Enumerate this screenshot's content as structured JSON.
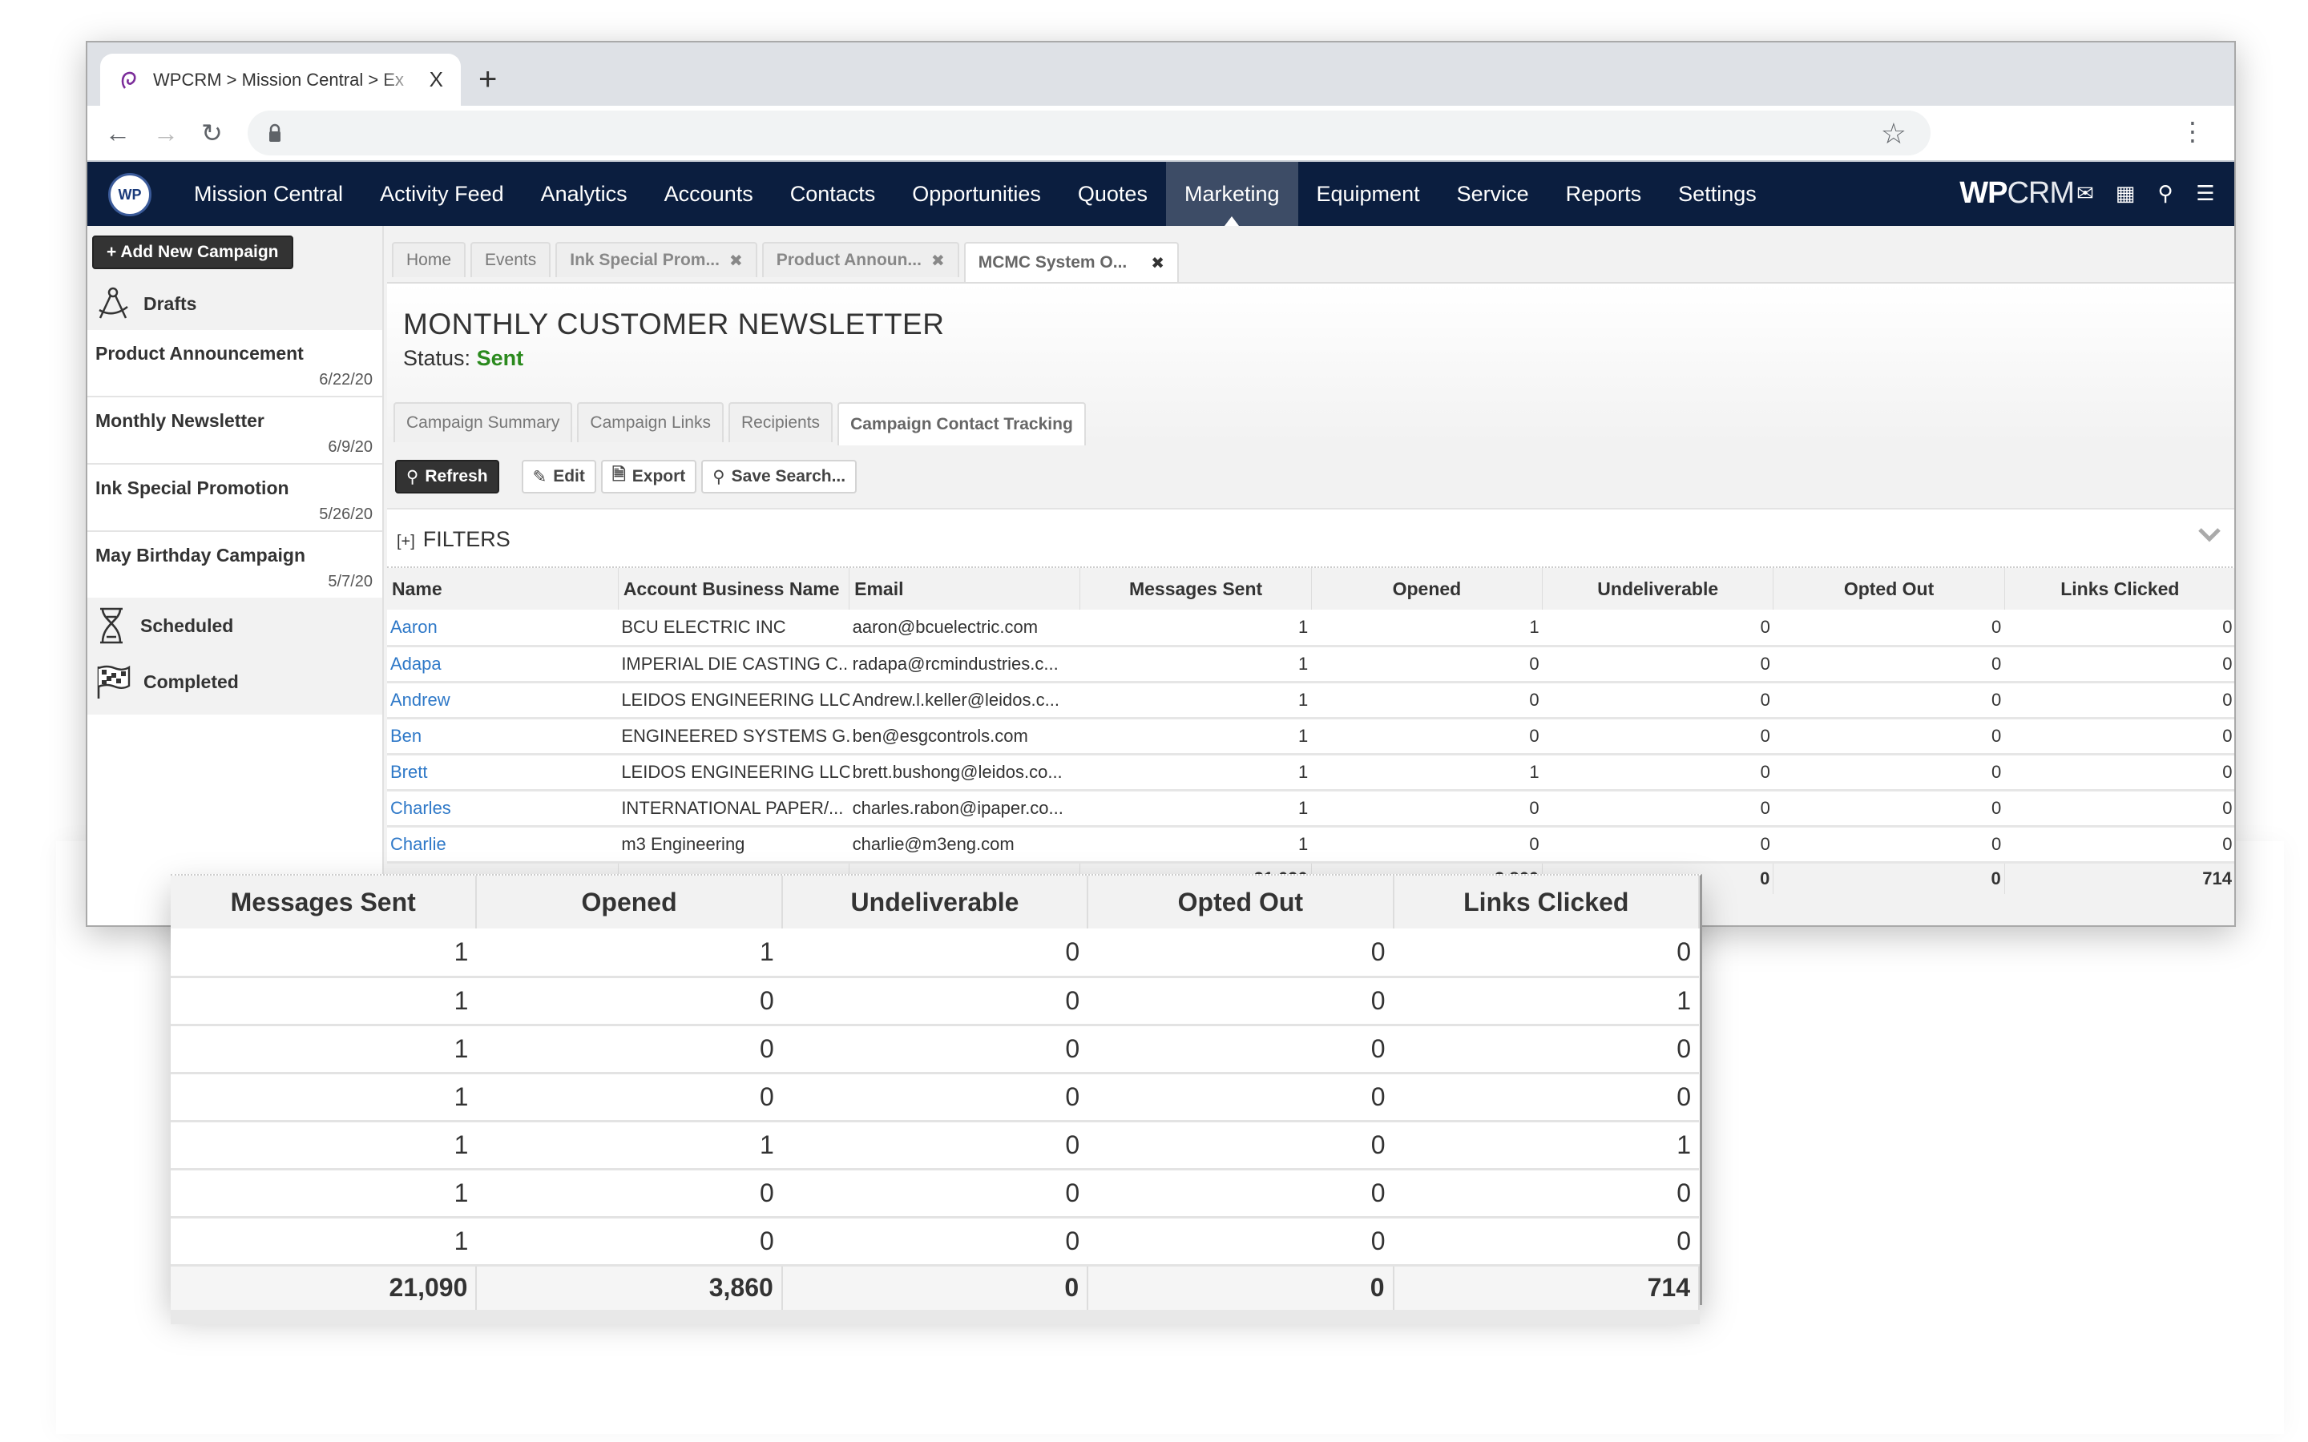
{
  "browser": {
    "tab_title": "WPCRM > Mission Central > Ex",
    "new_tab_label": "+",
    "close_tab_glyph": "X"
  },
  "nav": {
    "logo_text": "WP",
    "items": [
      {
        "label": "Mission Central"
      },
      {
        "label": "Activity Feed"
      },
      {
        "label": "Analytics"
      },
      {
        "label": "Accounts"
      },
      {
        "label": "Contacts"
      },
      {
        "label": "Opportunities"
      },
      {
        "label": "Quotes"
      },
      {
        "label": "Marketing",
        "active": true
      },
      {
        "label": "Equipment"
      },
      {
        "label": "Service"
      },
      {
        "label": "Reports"
      },
      {
        "label": "Settings"
      }
    ],
    "brand_bold": "WP",
    "brand_light": "CRM",
    "icons": [
      "mail-icon",
      "calendar-icon",
      "search-icon",
      "list-icon"
    ]
  },
  "sidebar": {
    "add_button": "+ Add New Campaign",
    "drafts_label": "Drafts",
    "drafts": [
      {
        "name": "Product Announcement",
        "date": "6/22/20"
      },
      {
        "name": "Monthly Newsletter",
        "date": "6/9/20"
      },
      {
        "name": "Ink Special Promotion",
        "date": "5/26/20"
      },
      {
        "name": "May Birthday Campaign",
        "date": "5/7/20"
      }
    ],
    "scheduled_label": "Scheduled",
    "completed_label": "Completed"
  },
  "page_tabs": [
    {
      "label": "Home",
      "closable": false
    },
    {
      "label": "Events",
      "closable": false
    },
    {
      "label": "Ink Special Prom...",
      "closable": true
    },
    {
      "label": "Product Announ...",
      "closable": true
    },
    {
      "label": "MCMC System O...",
      "closable": true,
      "active": true
    }
  ],
  "campaign": {
    "title": "MONTHLY CUSTOMER NEWSLETTER",
    "status_label": "Status:",
    "status_value": "Sent",
    "status_color": "#2b8a1e"
  },
  "sub_tabs": [
    {
      "label": "Campaign Summary"
    },
    {
      "label": "Campaign Links"
    },
    {
      "label": "Recipients"
    },
    {
      "label": "Campaign Contact Tracking",
      "active": true
    }
  ],
  "toolbar": {
    "refresh": "Refresh",
    "edit": "Edit",
    "export": "Export",
    "save_search": "Save Search..."
  },
  "filters": {
    "toggle": "[+]",
    "label": "FILTERS"
  },
  "table": {
    "columns": [
      "Name",
      "Account Business Name",
      "Email",
      "Messages Sent",
      "Opened",
      "Undeliverable",
      "Opted Out",
      "Links Clicked"
    ],
    "rows": [
      {
        "name": "Aaron",
        "account": "BCU ELECTRIC INC",
        "email": "aaron@bcuelectric.com",
        "sent": "1",
        "opened": "1",
        "undeliverable": "0",
        "opted_out": "0",
        "links": "0"
      },
      {
        "name": "Adapa",
        "account": "IMPERIAL DIE CASTING C...",
        "email": "radapa@rcmindustries.c...",
        "sent": "1",
        "opened": "0",
        "undeliverable": "0",
        "opted_out": "0",
        "links": "0"
      },
      {
        "name": "Andrew",
        "account": "LEIDOS ENGINEERING LLC",
        "email": "Andrew.l.keller@leidos.c...",
        "sent": "1",
        "opened": "0",
        "undeliverable": "0",
        "opted_out": "0",
        "links": "0"
      },
      {
        "name": "Ben",
        "account": "ENGINEERED SYSTEMS G...",
        "email": "ben@esgcontrols.com",
        "sent": "1",
        "opened": "0",
        "undeliverable": "0",
        "opted_out": "0",
        "links": "0"
      },
      {
        "name": "Brett",
        "account": "LEIDOS ENGINEERING LLC",
        "email": "brett.bushong@leidos.co...",
        "sent": "1",
        "opened": "1",
        "undeliverable": "0",
        "opted_out": "0",
        "links": "0"
      },
      {
        "name": "Charles",
        "account": "INTERNATIONAL PAPER/...",
        "email": "charles.rabon@ipaper.co...",
        "sent": "1",
        "opened": "0",
        "undeliverable": "0",
        "opted_out": "0",
        "links": "0"
      },
      {
        "name": "Charlie",
        "account": "m3 Engineering",
        "email": "charlie@m3eng.com",
        "sent": "1",
        "opened": "0",
        "undeliverable": "0",
        "opted_out": "0",
        "links": "0"
      }
    ],
    "totals": {
      "sent": "21,090",
      "opened": "3,860",
      "undeliverable": "0",
      "opted_out": "0",
      "links": "714"
    }
  },
  "zoom_panel": {
    "columns": [
      "Messages Sent",
      "Opened",
      "Undeliverable",
      "Opted Out",
      "Links Clicked"
    ],
    "rows": [
      [
        "1",
        "1",
        "0",
        "0",
        "0"
      ],
      [
        "1",
        "0",
        "0",
        "0",
        "1"
      ],
      [
        "1",
        "0",
        "0",
        "0",
        "0"
      ],
      [
        "1",
        "0",
        "0",
        "0",
        "0"
      ],
      [
        "1",
        "1",
        "0",
        "0",
        "1"
      ],
      [
        "1",
        "0",
        "0",
        "0",
        "0"
      ],
      [
        "1",
        "0",
        "0",
        "0",
        "0"
      ]
    ],
    "totals": [
      "21,090",
      "3,860",
      "0",
      "0",
      "714"
    ]
  }
}
